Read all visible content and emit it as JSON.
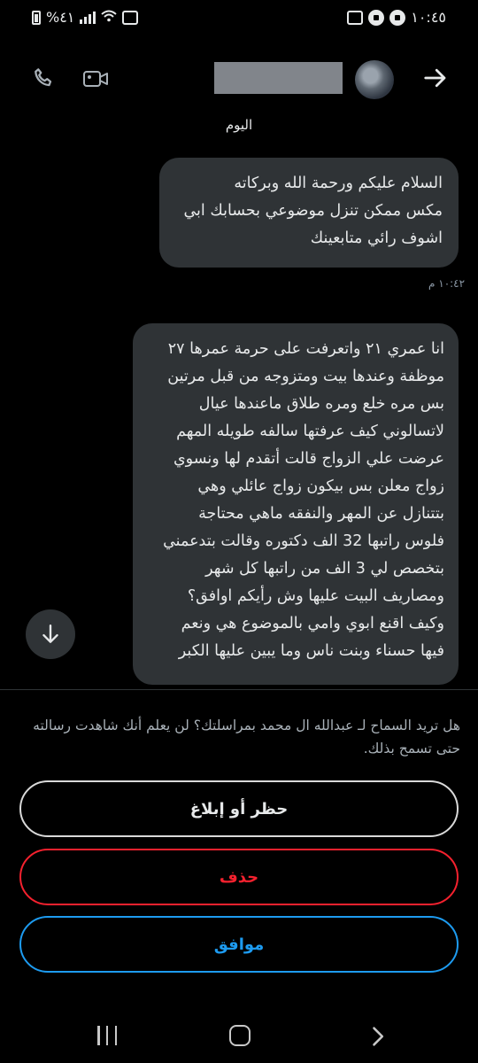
{
  "status_bar": {
    "time": "١٠:٤٥",
    "battery_text": "%٤١"
  },
  "header": {
    "contact_name_hidden": true
  },
  "conversation": {
    "day_label": "اليوم",
    "messages": [
      {
        "lines": [
          "السلام عليكم ورحمة الله وبركاته",
          "مكس ممكن تنزل موضوعي بحسابك ابي",
          "اشوف رائي متابعينك"
        ],
        "time": "١٠:٤٢ م"
      },
      {
        "lines": [
          "انا عمري ٢١ واتعرفت على حرمة عمرها ٢٧",
          "موظفة وعندها بيت ومتزوجه من قبل مرتين",
          "بس مره خلع ومره طلاق ماعندها عيال",
          "لاتسالوني كيف عرفتها سالفه طويله المهم",
          "عرضت علي الزواج قالت أتقدم لها ونسوي",
          "زواج معلن بس بيكون زواج عائلي وهي",
          "بتتنازل عن المهر والنفقه ماهي محتاجة",
          "فلوس راتبها 32 الف دكتوره وقالت بتدعمني",
          "بتخصص لي 3 الف من راتبها كل شهر",
          "ومصاريف البيت عليها وش رأيكم اوافق؟",
          "وكيف اقنع ابوي وامي بالموضوع هي ونعم",
          "فيها حسناء وبنت ناس  وما يبين عليها الكبر"
        ]
      }
    ]
  },
  "request_prompt": {
    "text": "هل تريد السماح لـ عبدالله ال محمد بمراسلتك؟ لن يعلم أنك شاهدت رسالته حتى تسمح بذلك."
  },
  "actions": {
    "block_report": "حظر أو إبلاغ",
    "delete": "حذف",
    "accept": "موافق"
  },
  "colors": {
    "bubble": "#2f3336",
    "danger": "#f4212e",
    "accent": "#1d9bf0"
  }
}
